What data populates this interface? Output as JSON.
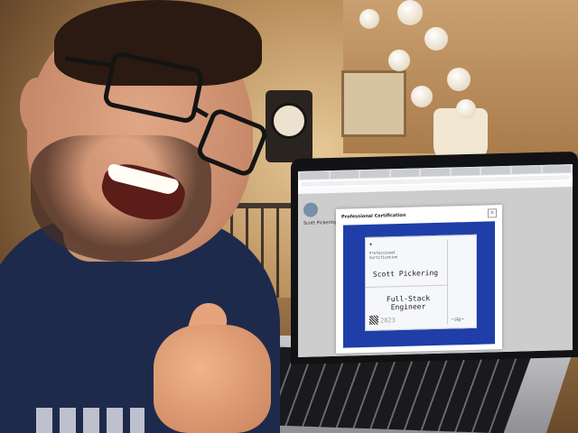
{
  "browser": {
    "tabs": [
      "",
      "",
      "",
      "",
      "",
      "",
      "",
      "",
      ""
    ],
    "url": "",
    "bookmarks": [
      "",
      "",
      "",
      "",
      "",
      ""
    ]
  },
  "profile": {
    "name": "Scott Pickering",
    "sidebar_items": [
      "",
      "",
      ""
    ]
  },
  "modal": {
    "title": "Professional Certification",
    "close": "×"
  },
  "certificate": {
    "type_line1": "Professional",
    "type_line2": "Certification",
    "name": "Scott Pickering",
    "role": "Full-Stack Engineer",
    "year": "2023"
  },
  "colors": {
    "certificate_background": "#1f3ea8",
    "shirt": "#1e2a4c"
  }
}
